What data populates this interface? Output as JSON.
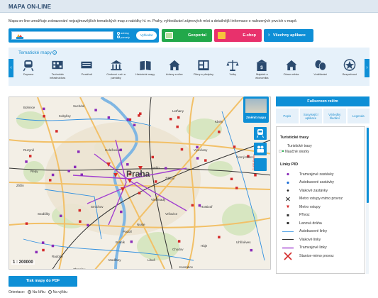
{
  "page": {
    "title": "MAPA ON-LINE"
  },
  "intro": "Mapa on-line umožňuje zobrazování nejzajímavějších tematických map z nabídky hl. m. Prahy, vyhledávání zájmových míst a detailnější informace o nalezených prvcích v mapě.",
  "search": {
    "placeholder": "",
    "options": [
      "adresy",
      "parcely"
    ],
    "selected": "parcely",
    "button": "Vyhledat"
  },
  "links": {
    "geoportal": "Geoportal",
    "eshop": "E-shop",
    "apps": "Všechny aplikace"
  },
  "thematic": {
    "title": "Tematické mapy",
    "categories": [
      {
        "label": "Doprava",
        "icon": "train-icon"
      },
      {
        "label": "Technická infrastruktura",
        "icon": "pipes-icon"
      },
      {
        "label": "Prostředí",
        "icon": "environment-icon"
      },
      {
        "label": "Cestovní ruch a památky",
        "icon": "monument-icon"
      },
      {
        "label": "Historické mapy",
        "icon": "book-map-icon"
      },
      {
        "label": "Adresy a ulice",
        "icon": "house-icon"
      },
      {
        "label": "Plány a předpisy",
        "icon": "blueprint-icon"
      },
      {
        "label": "Volby",
        "icon": "scales-icon"
      },
      {
        "label": "Majetek a ekonomika",
        "icon": "building-icon"
      },
      {
        "label": "Obraz města",
        "icon": "city-house-icon"
      },
      {
        "label": "Vzdělávání",
        "icon": "masks-icon"
      },
      {
        "label": "Bezpečnost",
        "icon": "shield-star-icon"
      }
    ]
  },
  "map": {
    "scale": "1 : 200000",
    "change_map": "Změnit mapu",
    "copyright": "© IPR Praha",
    "place_labels": [
      "Bohnice",
      "Kobylisy",
      "Holešovice",
      "Karlín",
      "Praha",
      "Smíchov",
      "Žižkov",
      "Vinohrady",
      "Vršovice",
      "Nusle",
      "Podolí",
      "Braník",
      "Modřany",
      "Chodov",
      "Háje",
      "Zličín",
      "Stodůlky",
      "Řepy",
      "Ruzyně",
      "Suchdol",
      "Letňany",
      "Kbely",
      "Vysočany",
      "Černý Most",
      "Hostivař",
      "Uhříněves",
      "Radotín",
      "Zbraslav",
      "Libuš",
      "Kunratice"
    ]
  },
  "panel": {
    "fullscreen": "Fullscreen režim",
    "tabs": [
      "Popis",
      "Související aplikace",
      "Výsledky hledání",
      "Legenda"
    ]
  },
  "legend": {
    "section1": "Turistické trasy",
    "trail_group": "Turistické trasy",
    "nature_trails": "Naučné stezky",
    "section2": "Linky PID",
    "items": [
      {
        "label": "Tramvajové zastávky",
        "color": "#8a2bb8"
      },
      {
        "label": "Autobusové zastávky",
        "color": "#1f6fd6"
      },
      {
        "label": "Vlakové zastávky",
        "color": "#222222"
      },
      {
        "label": "Metro vstupy-mimo provoz",
        "color": "#222222"
      },
      {
        "label": "Metro vstupy",
        "color": "#d42a2a"
      },
      {
        "label": "Přívoz",
        "color": "#333333"
      },
      {
        "label": "Lanová dráha",
        "color": "#333333"
      },
      {
        "label": "Autobusové linky",
        "color": "#2f8fe0"
      },
      {
        "label": "Vlakové linky",
        "color": "#333333"
      },
      {
        "label": "Tramvajové linky",
        "color": "#a23fd0"
      },
      {
        "label": "Stanice-mimo provoz",
        "color": "#d42a2a"
      }
    ]
  },
  "footer": {
    "pdf_button": "Tisk mapy do PDF",
    "orientation_label": "Orientace:",
    "orientation_options": [
      "Na šířku",
      "Na výšku"
    ],
    "orientation_selected": "Na šířku"
  }
}
